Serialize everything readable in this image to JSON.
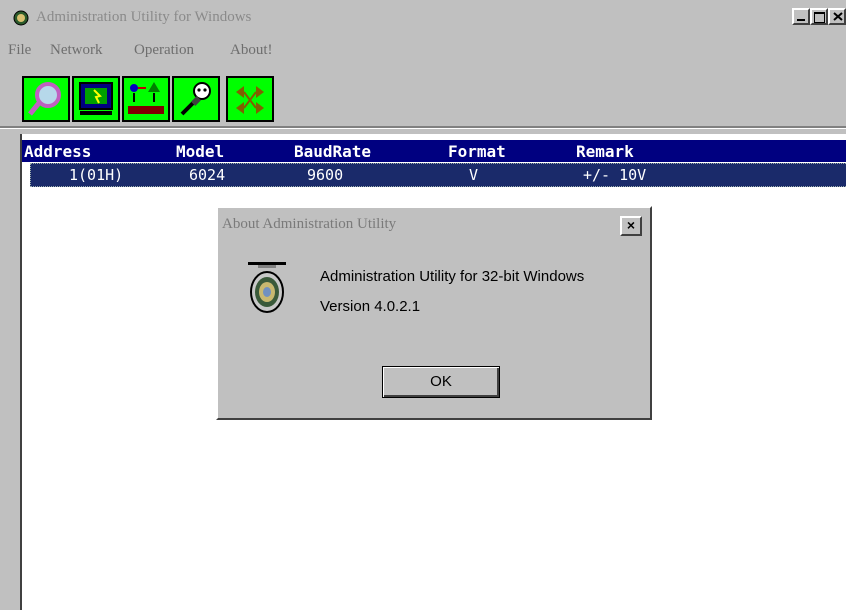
{
  "window": {
    "title": "Administration Utility for Windows"
  },
  "menu": [
    "File",
    "Network",
    "Operation",
    "About!"
  ],
  "toolbar": {
    "buttons": [
      "search-icon",
      "monitor-icon",
      "network-map-icon",
      "plug-icon",
      "arrows-icon"
    ]
  },
  "list": {
    "headers": [
      "Address",
      "Model",
      "BaudRate",
      "Format",
      "Remark"
    ],
    "rows": [
      [
        "1(01H)",
        "6024",
        "9600",
        "V",
        "+/- 10V"
      ]
    ]
  },
  "dialog": {
    "title": "About Administration Utility",
    "close_label": "×",
    "line1": "Administration Utility for 32-bit Windows",
    "line2": "Version 4.0.2.1",
    "ok_label": "OK"
  }
}
